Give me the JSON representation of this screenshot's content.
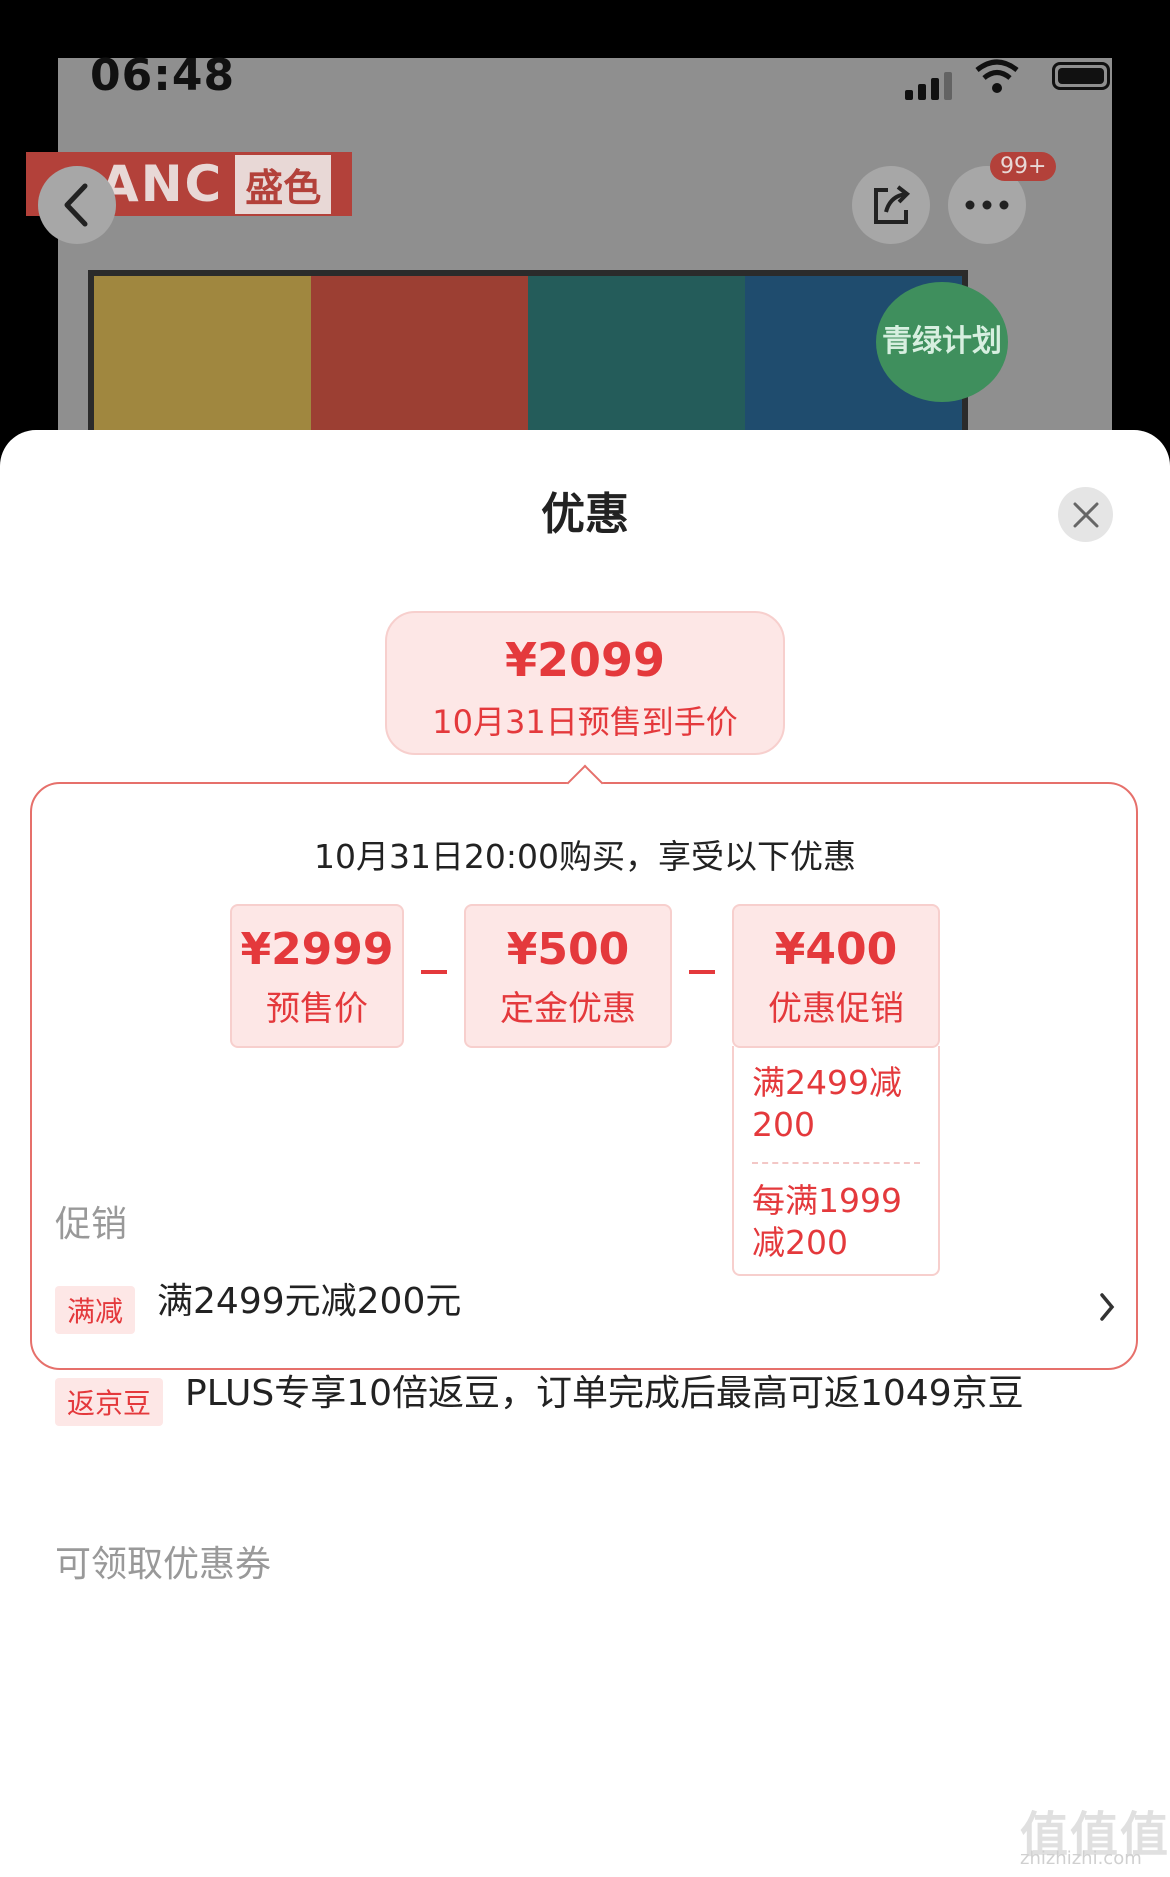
{
  "status_bar": {
    "time": "06:48"
  },
  "background_page": {
    "logo_text": "ANC",
    "logo_text_cn": "盛色",
    "badge_count": "99+",
    "green_badge": "青绿计划"
  },
  "sheet": {
    "title": "优惠",
    "final_price": {
      "amount": "¥2099",
      "label": "10月31日预售到手价"
    },
    "breakdown_title": "10月31日20:00购买，享受以下优惠",
    "breakdown": [
      {
        "amount": "¥2999",
        "label": "预售价"
      },
      {
        "amount": "¥500",
        "label": "定金优惠"
      },
      {
        "amount": "¥400",
        "label": "优惠促销"
      }
    ],
    "promo_rules": [
      "满2499减200",
      "每满1999减200"
    ],
    "section_promo_label": "促销",
    "promos": [
      {
        "tag": "满减",
        "text": "满2499元减200元"
      },
      {
        "tag": "返京豆",
        "text": "PLUS专享10倍返豆，订单完成后最高可返1049京豆"
      }
    ],
    "section_coupon_label": "可领取优惠券"
  },
  "watermark": {
    "text": "值值值",
    "sub": "zhizhizhi.com"
  }
}
